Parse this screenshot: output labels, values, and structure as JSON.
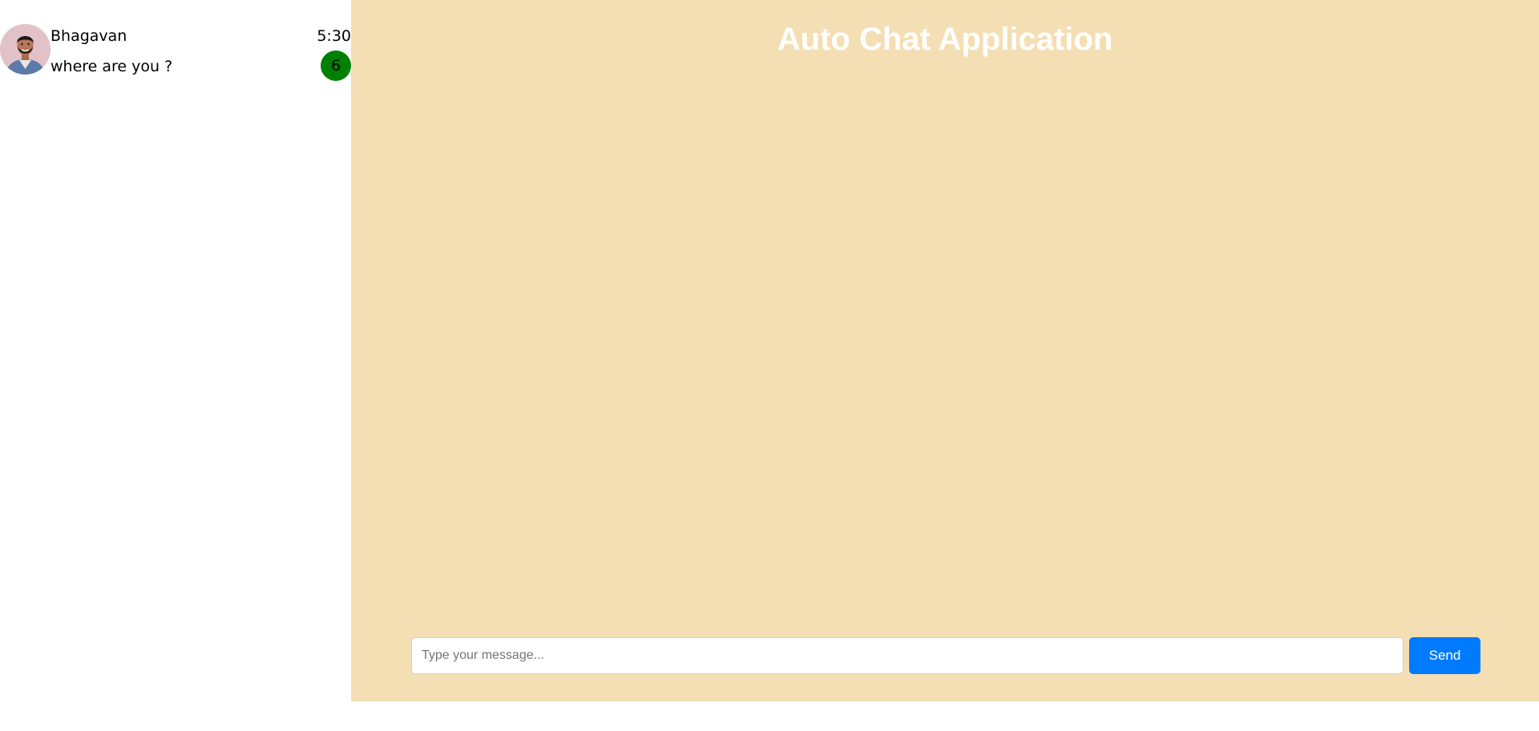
{
  "sidebar": {
    "chats": [
      {
        "name": "Bhagavan",
        "time": "5:30",
        "last_message": "where are you ?",
        "unread_count": "6",
        "avatar_icon": "user-avatar-photo"
      }
    ]
  },
  "main": {
    "title": "Auto Chat Application",
    "composer": {
      "placeholder": "Type your message...",
      "value": "",
      "send_label": "Send"
    }
  },
  "colors": {
    "main_background": "#f4deb3",
    "send_button": "#007bff",
    "unread_badge": "#008000",
    "title_text": "#ffffff"
  }
}
